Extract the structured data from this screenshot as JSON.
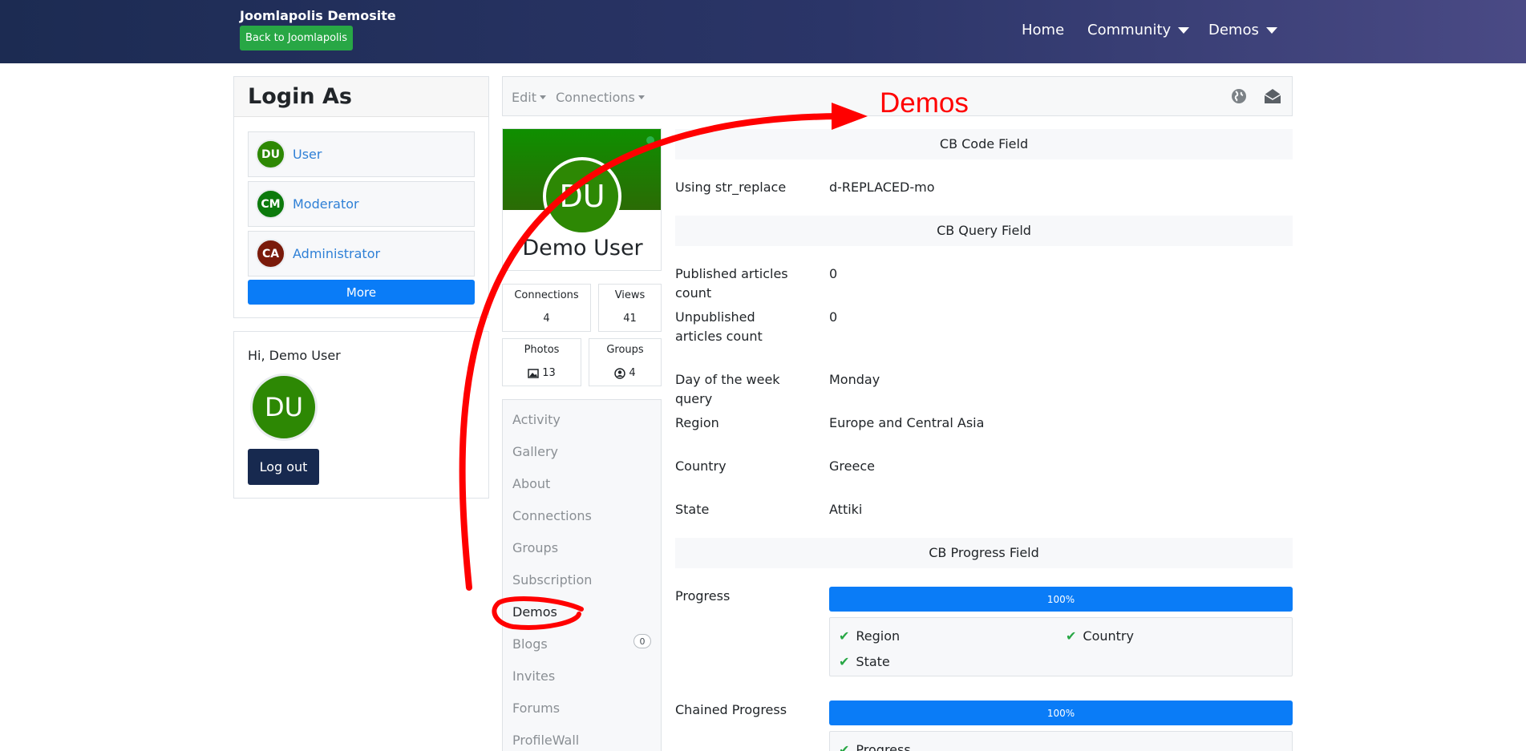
{
  "navbar": {
    "brand": "Joomlapolis Demosite",
    "back_button": "Back to Joomlapolis",
    "items": [
      {
        "label": "Home"
      },
      {
        "label": "Community"
      },
      {
        "label": "Demos"
      }
    ]
  },
  "login_as": {
    "title": "Login As",
    "users": [
      {
        "initials": "DU",
        "label": "User",
        "color": "#2d8804"
      },
      {
        "initials": "CM",
        "label": "Moderator",
        "color": "#0c7a0c"
      },
      {
        "initials": "CA",
        "label": "Administrator",
        "color": "#7a1a0a"
      }
    ],
    "more_button": "More"
  },
  "greeting": {
    "text": "Hi, Demo User",
    "initials": "DU",
    "logout_button": "Log out"
  },
  "toolbar": {
    "edit": "Edit",
    "connections": "Connections",
    "icons": [
      "globe-icon",
      "envelope-open-icon"
    ]
  },
  "profile": {
    "initials": "DU",
    "name": "Demo User",
    "stats": {
      "connections": {
        "label": "Connections",
        "value": "4"
      },
      "views": {
        "label": "Views",
        "value": "41"
      },
      "photos": {
        "label": "Photos",
        "value": "13"
      },
      "groups": {
        "label": "Groups",
        "value": "4"
      }
    }
  },
  "tabs": [
    {
      "label": "Activity"
    },
    {
      "label": "Gallery"
    },
    {
      "label": "About"
    },
    {
      "label": "Connections"
    },
    {
      "label": "Groups"
    },
    {
      "label": "Subscription"
    },
    {
      "label": "Demos",
      "active": true
    },
    {
      "label": "Blogs",
      "badge": "0"
    },
    {
      "label": "Invites"
    },
    {
      "label": "Forums"
    },
    {
      "label": "ProfileWall"
    }
  ],
  "sections": {
    "code": {
      "title": "CB Code Field",
      "label": "Using str_replace",
      "value": "d-REPLACED-mo"
    },
    "query": {
      "title": "CB Query Field",
      "fields": [
        {
          "label": "Published articles count",
          "value": "0"
        },
        {
          "label": "Unpublished articles count",
          "value": "0"
        },
        {
          "label": "Day of the week query",
          "value": "Monday"
        },
        {
          "label": "Region",
          "value": "Europe and Central Asia"
        },
        {
          "label": "Country",
          "value": "Greece"
        },
        {
          "label": "State",
          "value": "Attiki"
        }
      ]
    },
    "progress": {
      "title": "CB Progress Field",
      "progress_label": "Progress",
      "progress_value": "100%",
      "checks": [
        "Region",
        "Country",
        "State"
      ],
      "chained_label": "Chained Progress",
      "chained_value": "100%",
      "chained_checks": [
        "Progress"
      ]
    }
  },
  "annotation": {
    "text": "Demos",
    "color": "#ff0000"
  }
}
